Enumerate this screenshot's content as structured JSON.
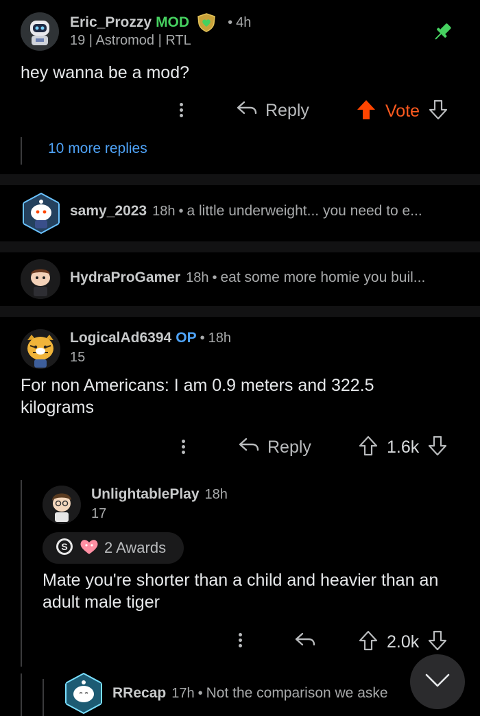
{
  "comment1": {
    "username": "Eric_Prozzy",
    "mod_badge": "MOD",
    "time": "4h",
    "flair": "19 | Astromod | RTL",
    "body": "hey wanna be a mod?",
    "reply_label": "Reply",
    "vote_label": "Vote",
    "more_replies": "10 more replies",
    "icons": [
      "pin-icon",
      "shield-heart-icon",
      "reply-icon",
      "upvote-icon",
      "downvote-icon",
      "more-options-icon"
    ],
    "colors": {
      "mod": "#46d160",
      "vote": "#ff5a1f",
      "pin": "#46d160"
    }
  },
  "collapsed": [
    {
      "username": "samy_2023",
      "time": "18h",
      "preview": "a little underweight... you need to e..."
    },
    {
      "username": "HydraProGamer",
      "time": "18h",
      "preview": "eat some more homie you buil..."
    }
  ],
  "comment2": {
    "username": "LogicalAd6394",
    "op_badge": "OP",
    "time": "18h",
    "flair": "15",
    "body": "For non Americans: I am 0.9 meters and 322.5 kilograms",
    "reply_label": "Reply",
    "score": "1.6k",
    "colors": {
      "op": "#4fa3f7"
    }
  },
  "comment3": {
    "username": "UnlightablePlay",
    "time": "18h",
    "flair": "17",
    "awards_label": "2 Awards",
    "body": "Mate you're shorter than a child and heavier than an adult male tiger",
    "score": "2.0k"
  },
  "comment4": {
    "username": "RRecap",
    "time": "17h",
    "preview": "Not the comparison we aske"
  },
  "fab": {
    "icon": "chevron-down-icon"
  }
}
